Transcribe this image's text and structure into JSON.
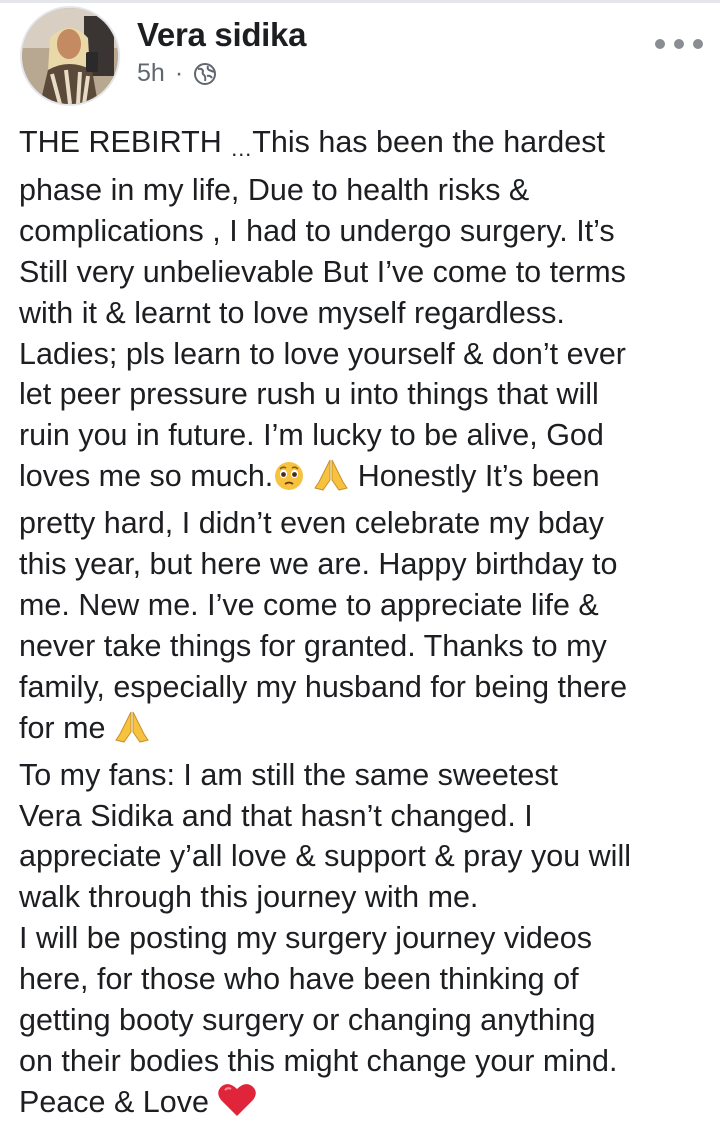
{
  "post": {
    "author": "Vera sidika",
    "timestamp": "5h",
    "separator": "·",
    "privacy_icon": "globe-icon",
    "more_icon": "more-horizontal-icon"
  },
  "body": {
    "line1a": "THE REBIRTH ",
    "line1b": "…",
    "line1c": "This has been the hardest",
    "line2": "phase in my life, Due to health risks &",
    "line3": "complications , I had to undergo surgery. It’s",
    "line4": "Still very unbelievable But I’ve come to terms",
    "line5": "with it & learnt to love myself regardless.",
    "line6": "Ladies; pls learn to love yourself & don’t ever",
    "line7": "let peer pressure rush u into things that will",
    "line8": "ruin you in future. I’m lucky to be alive, God",
    "line9a": "loves me so much.",
    "line9b": " Honestly It’s been",
    "line10": "pretty hard, I didn’t even celebrate my bday",
    "line11": "this year, but here we are. Happy birthday to",
    "line12": "me. New me. I’ve come to appreciate life &",
    "line13": "never take things for granted. Thanks to my",
    "line14": "family, especially my husband for being there",
    "line15": "for me ",
    "line16": "To my fans: I am still the same sweetest",
    "line17": "Vera Sidika and that hasn’t changed. I",
    "line18": "appreciate y’all love & support & pray you will",
    "line19": "walk through this journey with me.",
    "line20": "I will be posting my surgery journey videos",
    "line21": "here, for those who have been thinking of",
    "line22": "getting booty surgery or changing anything",
    "line23": "on their bodies this might change your mind.",
    "line24": "Peace & Love "
  },
  "emojis": [
    "pleading-face-emoji",
    "folded-hands-emoji",
    "red-heart-emoji"
  ],
  "colors": {
    "text": "#1c1e21",
    "meta": "#606770",
    "icon": "#8a8d91",
    "heart": "#e0243a",
    "emoji_yellow": "#f7c23e"
  }
}
